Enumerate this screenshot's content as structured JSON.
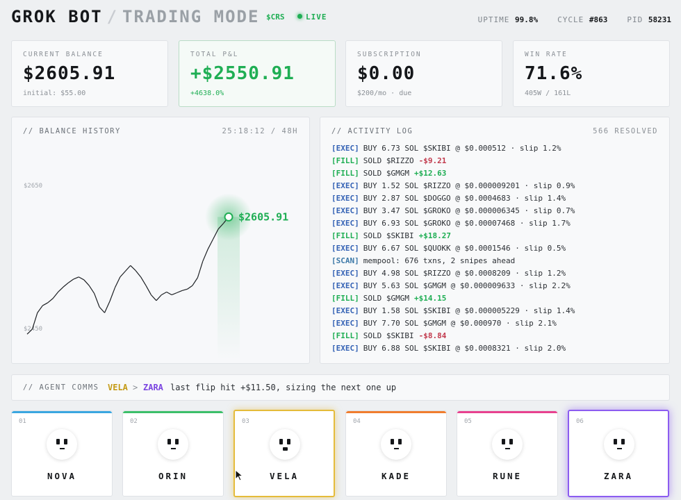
{
  "header": {
    "brand": "GROK BOT",
    "separator": "/",
    "mode": "TRADING MODE",
    "ticker": "$CRS",
    "live": "LIVE",
    "uptime_label": "UPTIME",
    "uptime": "99.8%",
    "cycle_label": "CYCLE",
    "cycle": "#863",
    "pid_label": "PID",
    "pid": "58231"
  },
  "metrics": [
    {
      "label": "CURRENT BALANCE",
      "value": "$2605.91",
      "sub": "initial: $55.00"
    },
    {
      "label": "TOTAL P&L",
      "value": "+$2550.91",
      "sub": "+4638.0%"
    },
    {
      "label": "SUBSCRIPTION",
      "value": "$0.00",
      "sub": "$200/mo · due"
    },
    {
      "label": "WIN RATE",
      "value": "71.6%",
      "sub": "405W / 161L"
    }
  ],
  "balance_history": {
    "title": "// BALANCE HISTORY",
    "timer": "25:18:12 / 48H",
    "y_top_label": "$2650",
    "y_bottom_label": "$2450",
    "current_label": "$2605.91",
    "accent": "#1fae54"
  },
  "chart_data": {
    "type": "line",
    "title": "// BALANCE HISTORY",
    "ylim": [
      2450,
      2650
    ],
    "y_ticks": [
      "$2650",
      "$2450"
    ],
    "values": [
      2442,
      2449,
      2472,
      2482,
      2486,
      2492,
      2501,
      2508,
      2514,
      2519,
      2522,
      2518,
      2510,
      2499,
      2480,
      2472,
      2488,
      2507,
      2522,
      2530,
      2538,
      2531,
      2522,
      2510,
      2497,
      2489,
      2497,
      2501,
      2497,
      2500,
      2503,
      2505,
      2510,
      2521,
      2544,
      2561,
      2575,
      2589,
      2597,
      2605.91
    ],
    "last_value_label": "$2605.91"
  },
  "activity": {
    "title": "// ACTIVITY LOG",
    "resolved": "566 RESOLVED",
    "lines": [
      {
        "tag": "[EXEC]",
        "kind": "exec",
        "text": "BUY 6.73 SOL $SKIBI @ $0.000512 · slip 1.2%",
        "amt": "",
        "dir": ""
      },
      {
        "tag": "[FILL]",
        "kind": "fill",
        "text": "SOLD $RIZZO",
        "amt": "-$9.21",
        "dir": "down"
      },
      {
        "tag": "[FILL]",
        "kind": "fill",
        "text": "SOLD $GMGM",
        "amt": "+$12.63",
        "dir": "up"
      },
      {
        "tag": "[EXEC]",
        "kind": "exec",
        "text": "BUY 1.52 SOL $RIZZO @ $0.000009201 · slip 0.9%",
        "amt": "",
        "dir": ""
      },
      {
        "tag": "[EXEC]",
        "kind": "exec",
        "text": "BUY 2.87 SOL $DOGGO @ $0.0004683 · slip 1.4%",
        "amt": "",
        "dir": ""
      },
      {
        "tag": "[EXEC]",
        "kind": "exec",
        "text": "BUY 3.47 SOL $GROKO @ $0.000006345 · slip 0.7%",
        "amt": "",
        "dir": ""
      },
      {
        "tag": "[EXEC]",
        "kind": "exec",
        "text": "BUY 6.93 SOL $GROKO @ $0.00007468 · slip 1.7%",
        "amt": "",
        "dir": ""
      },
      {
        "tag": "[FILL]",
        "kind": "fill",
        "text": "SOLD $SKIBI",
        "amt": "+$18.27",
        "dir": "up"
      },
      {
        "tag": "[EXEC]",
        "kind": "exec",
        "text": "BUY 6.67 SOL $QUOKK @ $0.0001546 · slip 0.5%",
        "amt": "",
        "dir": ""
      },
      {
        "tag": "[SCAN]",
        "kind": "scan",
        "text": "mempool: 676 txns, 2 snipes ahead",
        "amt": "",
        "dir": ""
      },
      {
        "tag": "[EXEC]",
        "kind": "exec",
        "text": "BUY 4.98 SOL $RIZZO @ $0.0008209 · slip 1.2%",
        "amt": "",
        "dir": ""
      },
      {
        "tag": "[EXEC]",
        "kind": "exec",
        "text": "BUY 5.63 SOL $GMGM @ $0.000009633 · slip 2.2%",
        "amt": "",
        "dir": ""
      },
      {
        "tag": "[FILL]",
        "kind": "fill",
        "text": "SOLD $GMGM",
        "amt": "+$14.15",
        "dir": "up"
      },
      {
        "tag": "[EXEC]",
        "kind": "exec",
        "text": "BUY 1.58 SOL $SKIBI @ $0.000005229 · slip 1.4%",
        "amt": "",
        "dir": ""
      },
      {
        "tag": "[EXEC]",
        "kind": "exec",
        "text": "BUY 7.70 SOL $GMGM @ $0.000970 · slip 2.1%",
        "amt": "",
        "dir": ""
      },
      {
        "tag": "[FILL]",
        "kind": "fill",
        "text": "SOLD $SKIBI",
        "amt": "-$8.84",
        "dir": "down"
      },
      {
        "tag": "[EXEC]",
        "kind": "exec",
        "text": "BUY 6.88 SOL $SKIBI @ $0.0008321 · slip 2.0%",
        "amt": "",
        "dir": ""
      }
    ]
  },
  "comms": {
    "label": "// AGENT COMMS",
    "from": "VELA",
    "arrow": ">",
    "to": "ZARA",
    "message": "last flip hit +$11.50, sizing the next one up"
  },
  "agents": [
    {
      "num": "01",
      "name": "NOVA",
      "color": "#3aa6e0",
      "mouth": "flat"
    },
    {
      "num": "02",
      "name": "ORIN",
      "color": "#3cbf6a",
      "mouth": "flat"
    },
    {
      "num": "03",
      "name": "VELA",
      "color": "#e5bb3a",
      "mouth": "open"
    },
    {
      "num": "04",
      "name": "KADE",
      "color": "#f07d2e",
      "mouth": "flat"
    },
    {
      "num": "05",
      "name": "RUNE",
      "color": "#e8418f",
      "mouth": "flat"
    },
    {
      "num": "06",
      "name": "ZARA",
      "color": "#8c5cf0",
      "mouth": "flat"
    }
  ]
}
